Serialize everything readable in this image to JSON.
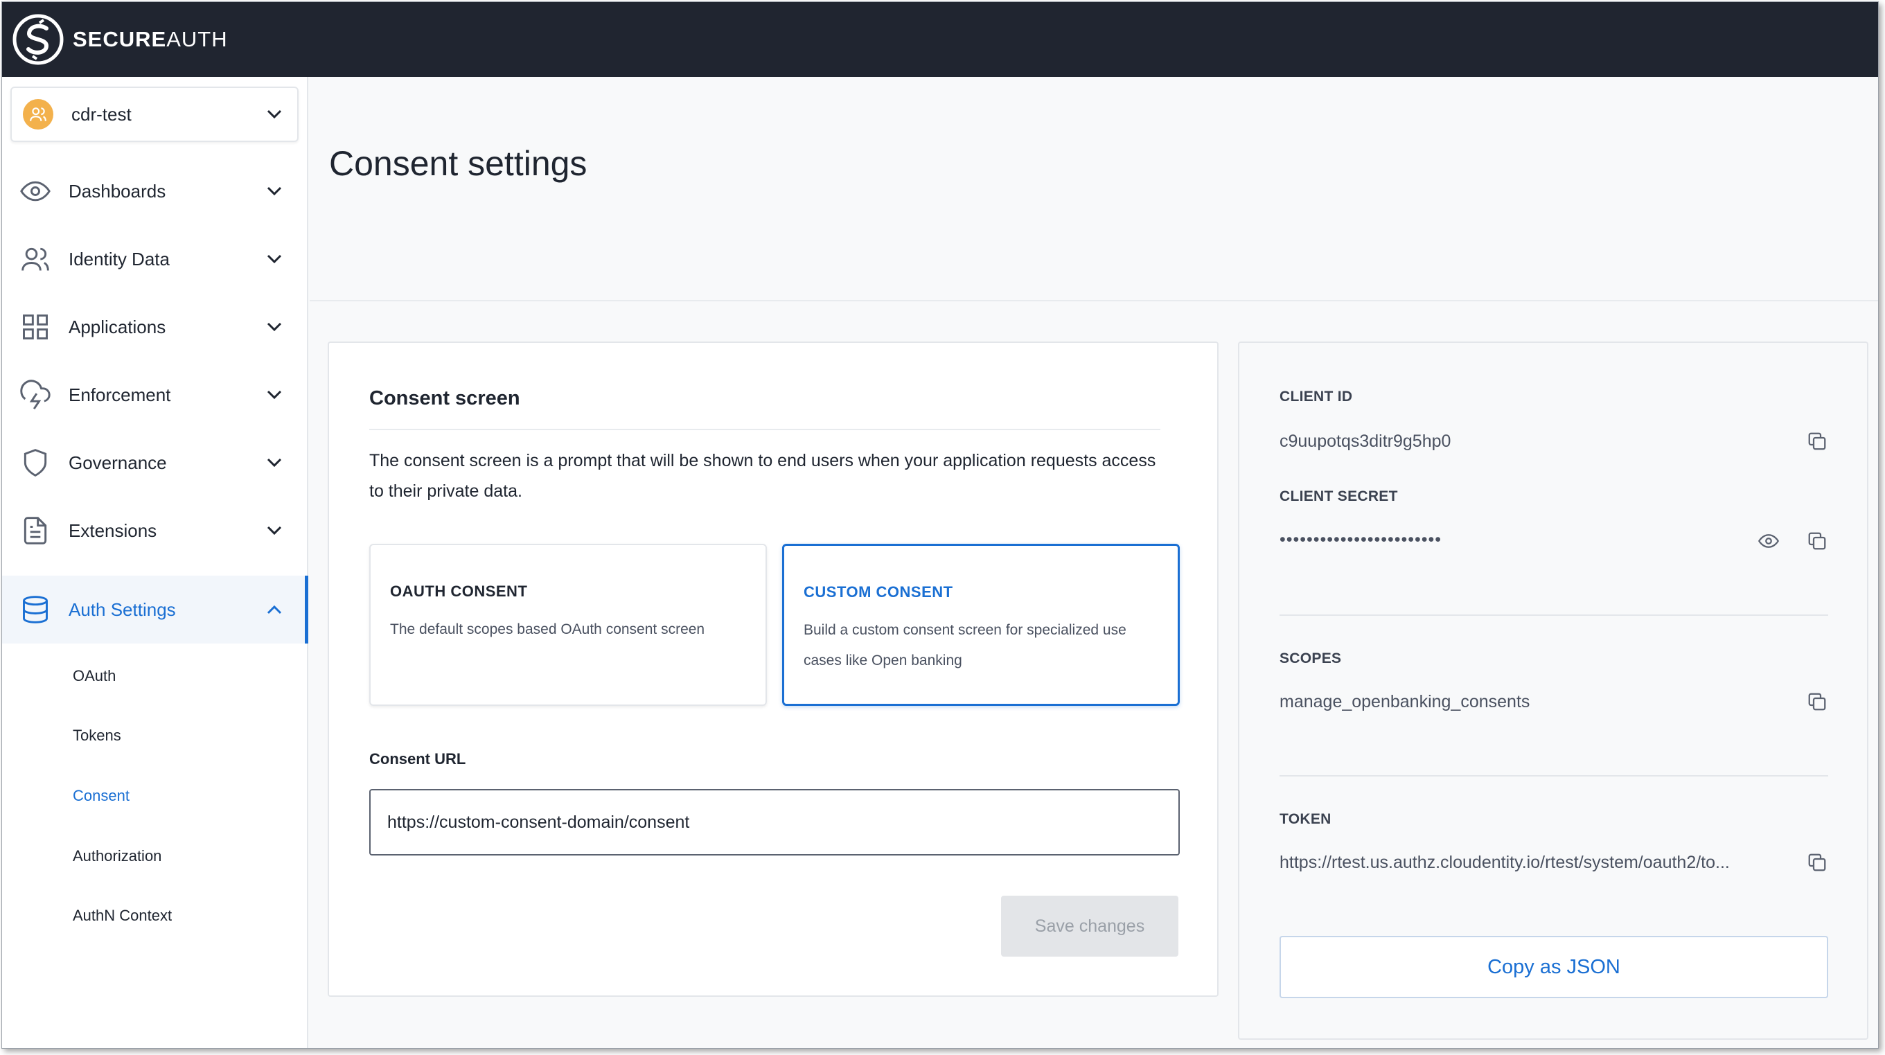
{
  "brand": {
    "name_bold": "SECURE",
    "name_rest": "AUTH",
    "logo_icon": "secureauth-logo-icon"
  },
  "tenant": {
    "name": "cdr-test",
    "icon": "users-icon",
    "avatar_color": "#f3b14c"
  },
  "colors": {
    "accent": "#1a6fd3",
    "topbar": "#202530",
    "disabled_bg": "#e3e5e8"
  },
  "sidebar": {
    "items": [
      {
        "label": "Dashboards",
        "icon": "eye-icon"
      },
      {
        "label": "Identity Data",
        "icon": "users-icon"
      },
      {
        "label": "Applications",
        "icon": "grid-icon"
      },
      {
        "label": "Enforcement",
        "icon": "cloud-lightning-icon"
      },
      {
        "label": "Governance",
        "icon": "shield-icon"
      },
      {
        "label": "Extensions",
        "icon": "document-icon"
      },
      {
        "label": "Auth Settings",
        "icon": "database-icon",
        "active": true
      }
    ],
    "sub_items": [
      {
        "label": "OAuth"
      },
      {
        "label": "Tokens"
      },
      {
        "label": "Consent",
        "active": true
      },
      {
        "label": "Authorization"
      },
      {
        "label": "AuthN Context"
      }
    ]
  },
  "page": {
    "title": "Consent settings"
  },
  "consent": {
    "section_title": "Consent screen",
    "description": "The consent screen is a prompt that will be shown to end users when your application requests access to their private data.",
    "options": [
      {
        "title": "OAUTH CONSENT",
        "description": "The default scopes based OAuth consent screen",
        "selected": false
      },
      {
        "title": "CUSTOM CONSENT",
        "description": "Build a custom consent screen for specialized use cases like Open banking",
        "selected": true
      }
    ],
    "url_label": "Consent URL",
    "url_value": "https://custom-consent-domain/consent",
    "save_label": "Save changes"
  },
  "client": {
    "client_id_label": "CLIENT ID",
    "client_id": "c9uupotqs3ditr9g5hp0",
    "client_secret_label": "CLIENT SECRET",
    "client_secret": "••••••••••••••••••••••••",
    "scopes_label": "SCOPES",
    "scopes": "manage_openbanking_consents",
    "token_label": "TOKEN",
    "token": "https://rtest.us.authz.cloudentity.io/rtest/system/oauth2/to...",
    "copy_json_label": "Copy as JSON"
  }
}
